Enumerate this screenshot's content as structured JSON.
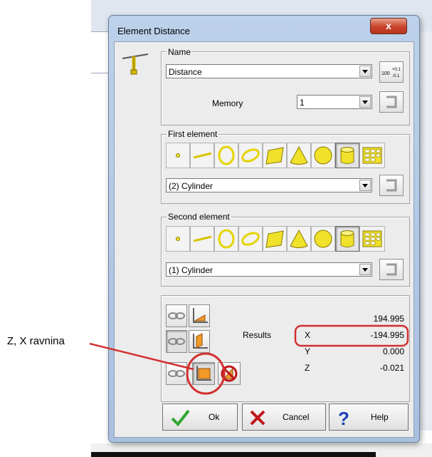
{
  "annotation": {
    "text": "Z, X ravnina",
    "color": "#d32f2f"
  },
  "dialog": {
    "title": "Element Distance",
    "close_label": "x",
    "name_group": {
      "legend": "Name",
      "name_value": "Distance",
      "memory_label": "Memory",
      "memory_value": "1",
      "tolerance_icon": "100+0.1/-0.1 tolerance-icon"
    },
    "first_element": {
      "legend": "First element",
      "selected": "(2) Cylinder"
    },
    "second_element": {
      "legend": "Second element",
      "selected": "(1) Cylinder"
    },
    "results": {
      "label": "Results",
      "top_value": "194.995",
      "rows": [
        {
          "axis": "X",
          "value": "-194.995"
        },
        {
          "axis": "Y",
          "value": "0.000"
        },
        {
          "axis": "Z",
          "value": "-0.021"
        }
      ]
    },
    "buttons": {
      "ok": "Ok",
      "cancel": "Cancel",
      "help": "Help"
    }
  },
  "colors": {
    "accent_yellow": "#f0e12a",
    "orange": "#f09a2a",
    "highlight_red": "#d32f2f"
  }
}
